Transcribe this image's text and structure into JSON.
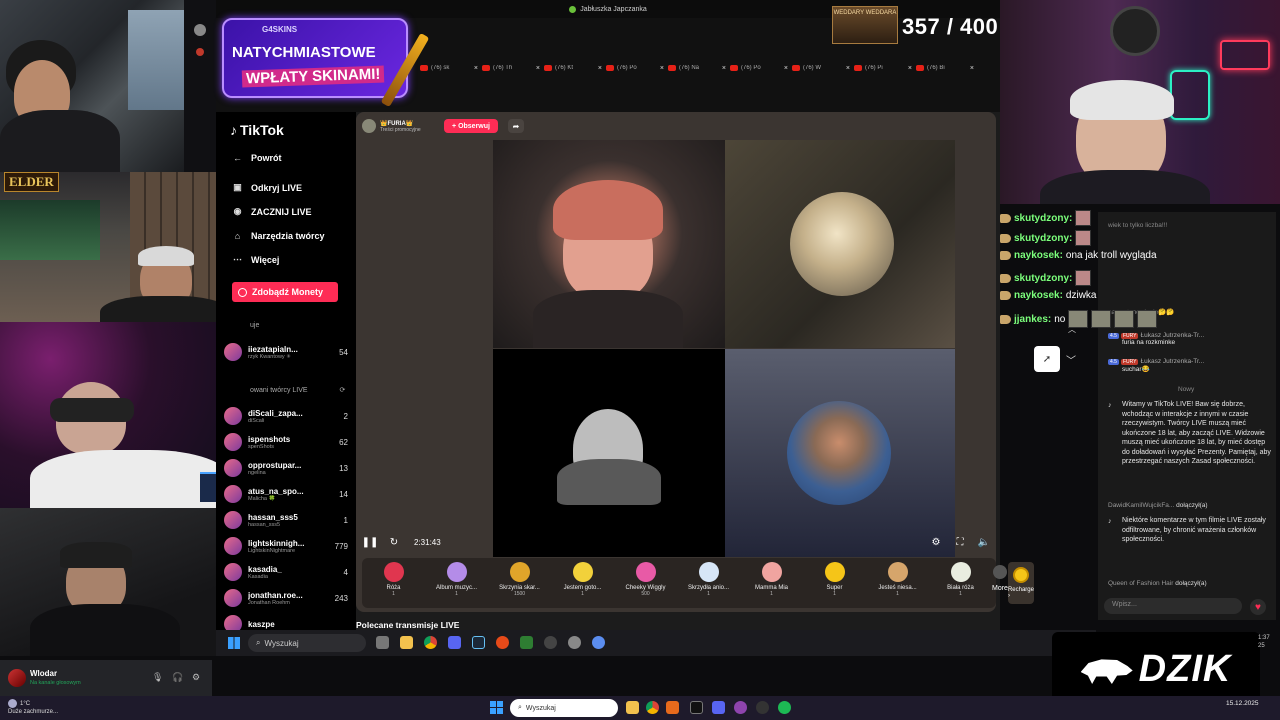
{
  "browser": {
    "window_title": "Jabłuszka Japczanka",
    "tabs": [
      {
        "label": "(76) sk"
      },
      {
        "label": "(76) Th"
      },
      {
        "label": "(76) Kt"
      },
      {
        "label": "(76) Po"
      },
      {
        "label": "(76) Na"
      },
      {
        "label": "(76) Po"
      },
      {
        "label": "(76) W"
      },
      {
        "label": "(76) Pi"
      },
      {
        "label": "(76) Bi"
      }
    ],
    "tab_close": "×"
  },
  "ad": {
    "brand": "G4SKINS",
    "line1": "NATYCHMIASTOWE",
    "line2": "WPŁATY SKINAMI!"
  },
  "counter": {
    "image_caption": "WEDDARY WEDDARA",
    "value": "357 / 400"
  },
  "cams": {
    "elder_badge": "ELDER"
  },
  "tiktok": {
    "logo": "TikTok",
    "nav": [
      {
        "label": "Powrót",
        "icon": "back-arrow-icon",
        "glyph": "←"
      },
      {
        "label": "Odkryj LIVE",
        "icon": "live-icon",
        "glyph": "▣"
      },
      {
        "label": "ZACZNIJ LIVE",
        "icon": "camera-icon",
        "glyph": "◉"
      },
      {
        "label": "Narzędzia twórcy",
        "icon": "tools-icon",
        "glyph": "⌂"
      },
      {
        "label": "Więcej",
        "icon": "more-icon",
        "glyph": "⋯"
      }
    ],
    "coins_button": "Zdobądź Monety",
    "section_following": "uje",
    "section_recommended": "owani twórcy LIVE",
    "creators_top": [
      {
        "name": "iiezatapialn...",
        "sub": "rzyk Kwantowy ✳",
        "viewers": "54"
      }
    ],
    "creators": [
      {
        "name": "diScali_zapa...",
        "sub": "diScali",
        "viewers": "2"
      },
      {
        "name": "ispenshots",
        "sub": "spenShots",
        "viewers": "62"
      },
      {
        "name": "opprostupar...",
        "sub": "ngelina",
        "viewers": "13"
      },
      {
        "name": "atus_na_spo...",
        "sub": "Malicha 🍀",
        "viewers": "14"
      },
      {
        "name": "hassan_sss5",
        "sub": "hassan_sss5",
        "viewers": "1"
      },
      {
        "name": "lightskinnigh...",
        "sub": "LightskinNightmare",
        "viewers": "779"
      },
      {
        "name": "kasadia_",
        "sub": "Kasadia",
        "viewers": "4"
      },
      {
        "name": "jonathan.roe...",
        "sub": "Jonathan Roehm",
        "viewers": "243"
      },
      {
        "name": "kaszpe",
        "sub": "",
        "viewers": ""
      }
    ],
    "host": {
      "name": "👑FURIA👑",
      "sub": "Treści promocyjne"
    },
    "follow": "+ Obserwuj",
    "share_glyph": "➦",
    "timer": "2:31:43",
    "gifts": [
      {
        "name": "Róża",
        "price": "1",
        "color": "#e0364f"
      },
      {
        "name": "Album muzyc...",
        "price": "1",
        "color": "#b48ce8"
      },
      {
        "name": "Skrzynia skar...",
        "price": "1500",
        "color": "#e0a52a"
      },
      {
        "name": "Jestem goto...",
        "price": "1",
        "color": "#f2d13b"
      },
      {
        "name": "Cheeky Wiggly",
        "price": "500",
        "color": "#e85aa6"
      },
      {
        "name": "Skrzydła anio...",
        "price": "1",
        "color": "#d7e6f7"
      },
      {
        "name": "Mamma Mia",
        "price": "1",
        "color": "#f0a4a0"
      },
      {
        "name": "Super",
        "price": "1",
        "color": "#f5c518"
      },
      {
        "name": "Jesteś niesa...",
        "price": "1",
        "color": "#d6a56b"
      },
      {
        "name": "Biała róża",
        "price": "1",
        "color": "#e9ede0"
      }
    ],
    "more": "More",
    "recharge": "Recharge ›",
    "recommended_streams": "Polecane transmisje LIVE"
  },
  "overlay_chat": [
    {
      "user": "skutydzony:",
      "msg": ""
    },
    {
      "user": "skutydzony:",
      "msg": ""
    },
    {
      "user": "naykosek:",
      "msg": "ona jak troll wygląda"
    },
    {
      "user": "skutydzony:",
      "msg": ""
    },
    {
      "user": "naykosek:",
      "msg": "dziwka"
    },
    {
      "user": "jjankes:",
      "msg": "no"
    }
  ],
  "tiktok_chat": {
    "dim_lines": [
      "wiek to tylko liczba!!!",
      "na zastanowienie🤔🤔"
    ],
    "rows": [
      {
        "badge1": "4.5",
        "badge2": "FURY",
        "user": "Łukasz Jutrzenka-Tr...",
        "msg": "furia na rozkminke"
      },
      {
        "badge1": "4.5",
        "badge2": "FURY",
        "user": "Łukasz Jutrzenka-Tr...",
        "msg": "suchar😂"
      }
    ],
    "new_label": "Nowy",
    "notice1": "Witamy w TikTok LIVE! Baw się dobrze, wchodząc w interakcje z innymi w czasie rzeczywistym. Twórcy LIVE muszą mieć ukończone 18 lat, aby zacząć LIVE. Widzowie muszą mieć ukończone 18 lat, by mieć dostęp do doładowań i wysyłać Prezenty. Pamiętaj, aby przestrzegać naszych Zasad społeczności.",
    "join1_user": "DawidKamilWujcikFa...",
    "join1_action": "dołączył(a)",
    "notice2": "Niektóre komentarze w tym filmie LIVE zostały odfiltrowane, by chronić wrażenia członków społeczności.",
    "join2_user": "Queen of Fashion Hair",
    "join2_action": "dołączył(a)",
    "input_placeholder": "Wpisz...",
    "heart": "♥"
  },
  "inner_taskbar": {
    "search": "Wyszukaj"
  },
  "dzik": {
    "word": "DZIK"
  },
  "clock_mini": {
    "time": "1:37",
    "date": "25"
  },
  "discord": {
    "user": "Wlodar",
    "status": "Na kanale głosowym"
  },
  "taskbar": {
    "weather_temp": "1°C",
    "weather_desc": "Duże zachmurze...",
    "search": "Wyszukaj",
    "time": "",
    "date": "15.12.2025"
  },
  "colors": {
    "tiktok_accent": "#fe2c55",
    "chat_user": "#7cff7c",
    "ad_bg": "#4a18c0"
  }
}
